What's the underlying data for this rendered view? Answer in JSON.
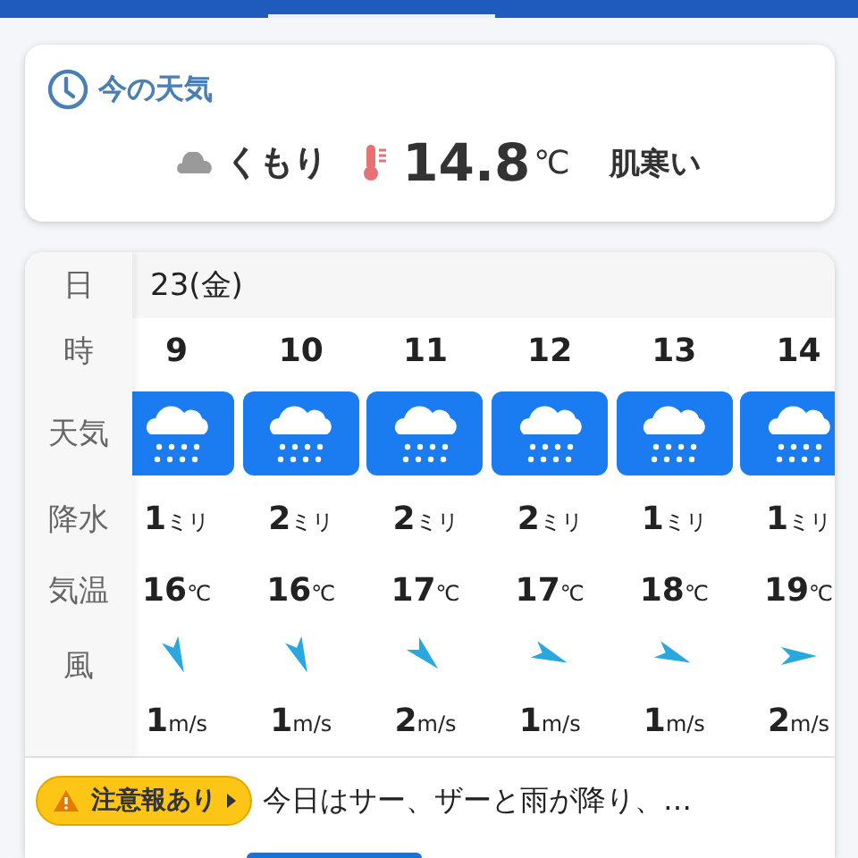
{
  "current": {
    "title": "今の天気",
    "condition": "くもり",
    "temperature": "14.8",
    "unit": "℃",
    "feeling": "肌寒い"
  },
  "forecast": {
    "labels": {
      "date": "日",
      "hour": "時",
      "weather": "天気",
      "precip": "降水",
      "temp": "気温",
      "wind": "風"
    },
    "date": "23(金)",
    "hours": [
      {
        "hour": "9",
        "kind": "rain",
        "precip": "1",
        "precip_unit": "ミリ",
        "temp": "16",
        "temp_unit": "℃",
        "wind": {
          "kind": "sse",
          "speed": "1",
          "unit": "m/s"
        }
      },
      {
        "hour": "10",
        "kind": "rain",
        "precip": "2",
        "precip_unit": "ミリ",
        "temp": "16",
        "temp_unit": "℃",
        "wind": {
          "kind": "sse",
          "speed": "1",
          "unit": "m/s"
        }
      },
      {
        "hour": "11",
        "kind": "rain",
        "precip": "2",
        "precip_unit": "ミリ",
        "temp": "17",
        "temp_unit": "℃",
        "wind": {
          "kind": "se",
          "speed": "2",
          "unit": "m/s"
        }
      },
      {
        "hour": "12",
        "kind": "rain",
        "precip": "2",
        "precip_unit": "ミリ",
        "temp": "17",
        "temp_unit": "℃",
        "wind": {
          "kind": "ese",
          "speed": "1",
          "unit": "m/s"
        }
      },
      {
        "hour": "13",
        "kind": "rain",
        "precip": "1",
        "precip_unit": "ミリ",
        "temp": "18",
        "temp_unit": "℃",
        "wind": {
          "kind": "ese",
          "speed": "1",
          "unit": "m/s"
        }
      },
      {
        "hour": "14",
        "kind": "rain",
        "precip": "1",
        "precip_unit": "ミリ",
        "temp": "19",
        "temp_unit": "℃",
        "wind": {
          "kind": "e",
          "speed": "2",
          "unit": "m/s"
        }
      }
    ]
  },
  "advisory": {
    "badge": "注意報あり",
    "text": "今日はサー、ザーと雨が降り、…"
  }
}
